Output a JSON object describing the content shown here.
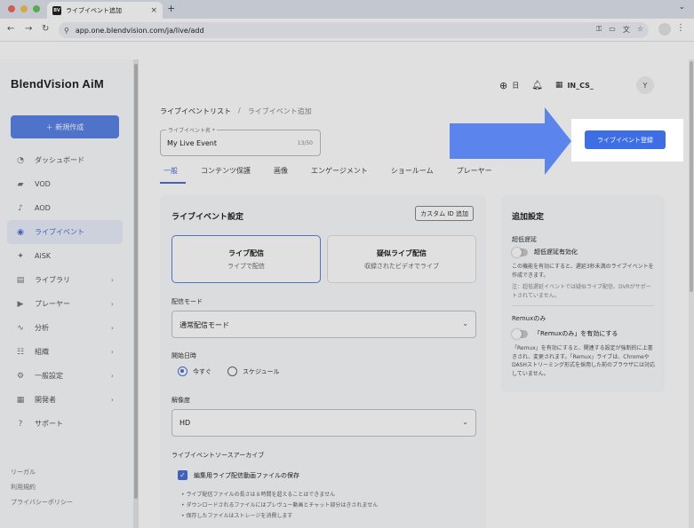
{
  "browser": {
    "tab_title": "ライブイベント追加",
    "favicon_text": "BV",
    "url": "app.one.blendvision.com/ja/live/add",
    "traffic_lights": [
      "#ee6a5e",
      "#f5be4f",
      "#61c454"
    ]
  },
  "sidebar": {
    "brand": "BlendVision AiM",
    "create_button": "＋ 新規作成",
    "items": [
      {
        "label": "ダッシュボード",
        "icon": "dashboard-icon",
        "glyph": "◔",
        "chevron": false,
        "active": false
      },
      {
        "label": "VOD",
        "icon": "video-icon",
        "glyph": "▰",
        "chevron": false,
        "active": false
      },
      {
        "label": "AOD",
        "icon": "music-icon",
        "glyph": "♪",
        "chevron": false,
        "active": false
      },
      {
        "label": "ライブイベント",
        "icon": "live-icon",
        "glyph": "◉",
        "chevron": false,
        "active": true
      },
      {
        "label": "AiSK",
        "icon": "ai-icon",
        "glyph": "✦",
        "chevron": false,
        "active": false
      },
      {
        "label": "ライブラリ",
        "icon": "library-icon",
        "glyph": "▤",
        "chevron": true,
        "active": false
      },
      {
        "label": "プレーヤー",
        "icon": "player-icon",
        "glyph": "▶",
        "chevron": true,
        "active": false
      },
      {
        "label": "分析",
        "icon": "analytics-icon",
        "glyph": "∿",
        "chevron": true,
        "active": false
      },
      {
        "label": "組織",
        "icon": "organization-icon",
        "glyph": "☷",
        "chevron": true,
        "active": false
      },
      {
        "label": "一般設定",
        "icon": "settings-icon",
        "glyph": "⚙",
        "chevron": true,
        "active": false
      },
      {
        "label": "開発者",
        "icon": "developer-icon",
        "glyph": "▦",
        "chevron": true,
        "active": false
      },
      {
        "label": "サポート",
        "icon": "support-icon",
        "glyph": "?",
        "chevron": false,
        "active": false
      }
    ],
    "footer": [
      "リーガル",
      "利用規約",
      "プライバシーポリシー"
    ]
  },
  "header": {
    "language": "日",
    "org": "IN_CS_",
    "avatar": "Y"
  },
  "breadcrumb": {
    "parent": "ライブイベントリスト",
    "separator": "/",
    "current": "ライブイベント追加"
  },
  "event_name": {
    "label": "ライブイベント名 *",
    "value": "My Live Event",
    "counter": "13/50"
  },
  "tabs": [
    "一般",
    "コンテンツ保護",
    "画像",
    "エンゲージメント",
    "ショールーム",
    "プレーヤー"
  ],
  "settings": {
    "title": "ライブイベント設定",
    "custom_id_button": "カスタム ID 追加",
    "modes": [
      {
        "title": "ライブ配信",
        "subtitle": "ライブで配信"
      },
      {
        "title": "疑似ライブ配信",
        "subtitle": "収録されたビデオでライブ"
      }
    ],
    "delivery_mode_label": "配信モード",
    "delivery_mode_value": "通常配信モード",
    "start_label": "開始日時",
    "start_options": [
      "今すぐ",
      "スケジュール"
    ],
    "resolution_label": "解像度",
    "resolution_value": "HD",
    "archive_label": "ライブイベントソースアーカイブ",
    "archive_checkbox": "編集用ライブ配信動画ファイルの保存",
    "archive_notes": [
      "• ライブ配信ファイルの長さは８時間を超えることはできません",
      "• ダウンロードされるファイルにはプレヴュー動画とチャット部分はきされません",
      "• 保存したファイルはストレージを消費します"
    ]
  },
  "additional": {
    "title": "追加設定",
    "ull_label": "超低遅延",
    "ull_toggle": "超低遅延有効化",
    "ull_desc": "この機能を有効にすると、遅延3秒未満のライブイベントを作成できます。",
    "ull_note": "注：超低遅延イベントでは疑似ライブ配信、DVRがサポートされていません。",
    "remux_label": "Remuxのみ",
    "remux_toggle": "「Remuxのみ」を有効にする",
    "remux_desc": "「Remux」を有効にすると、関連する設定が強制的に上書きされ、変更されます。「Remux」ライブは、ChromeやDASHストリーミング形式を採用した前のブラウザには対応していません。"
  },
  "register_button": "ライブイベント登録",
  "colors": {
    "accent": "#4a6fd6",
    "primary_button": "#3d6ee6",
    "arrow": "#5b84ec"
  }
}
